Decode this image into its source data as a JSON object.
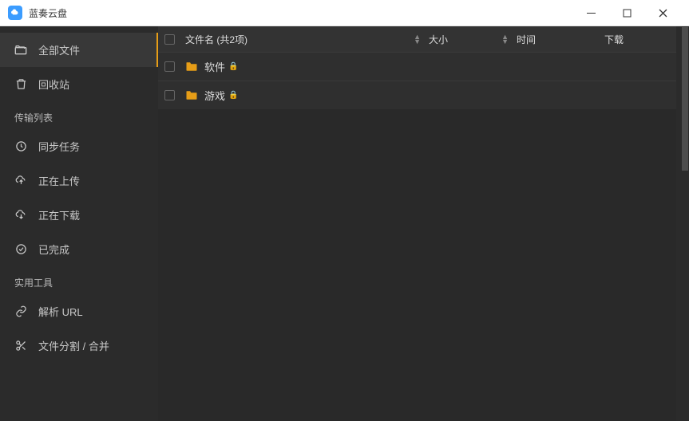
{
  "app": {
    "title": "蓝奏云盘"
  },
  "sidebar": {
    "items": [
      {
        "icon": "folders-icon",
        "label": "全部文件"
      },
      {
        "icon": "trash-icon",
        "label": "回收站"
      }
    ],
    "transfer_label": "传输列表",
    "transfer": [
      {
        "icon": "sync-icon",
        "label": "同步任务"
      },
      {
        "icon": "upload-icon",
        "label": "正在上传"
      },
      {
        "icon": "download-icon",
        "label": "正在下载"
      },
      {
        "icon": "check-icon",
        "label": "已完成"
      }
    ],
    "tools_label": "实用工具",
    "tools": [
      {
        "icon": "link-icon",
        "label": "解析 URL"
      },
      {
        "icon": "scissors-icon",
        "label": "文件分割 / 合并"
      }
    ]
  },
  "table": {
    "header": {
      "name": "文件名 (共2项)",
      "size": "大小",
      "time": "时间",
      "download": "下载"
    },
    "rows": [
      {
        "name": "软件",
        "locked": true,
        "size": "",
        "time": "",
        "download": ""
      },
      {
        "name": "游戏",
        "locked": true,
        "size": "",
        "time": "",
        "download": ""
      }
    ]
  }
}
